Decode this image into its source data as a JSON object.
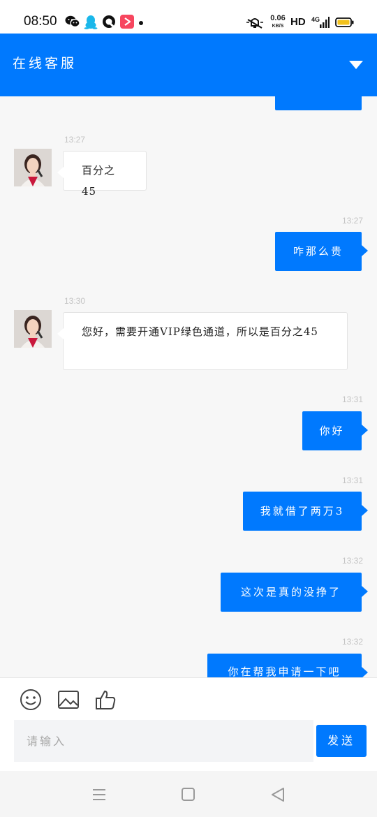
{
  "status_bar": {
    "time": "08:50",
    "net_speed_value": "0.06",
    "net_speed_unit": "KB/S",
    "hd_label": "HD",
    "signal_label": "4G",
    "apps": [
      "wechat-icon",
      "qq-icon",
      "q-app-icon",
      "video-app-icon"
    ]
  },
  "header": {
    "title": "在线客服",
    "dropdown_icon": "triangle-down-icon"
  },
  "messages": [
    {
      "side": "right",
      "text": "",
      "time": ""
    },
    {
      "side": "left",
      "time": "13:27",
      "text": "百分之45"
    },
    {
      "side": "right",
      "time": "13:27",
      "text": "咋那么贵"
    },
    {
      "side": "left",
      "time": "13:30",
      "text": "您好，需要开通VIP绿色通道，所以是百分之45"
    },
    {
      "side": "right",
      "time": "13:31",
      "text": "你好"
    },
    {
      "side": "right",
      "time": "13:31",
      "text": "我就借了两万3"
    },
    {
      "side": "right",
      "time": "13:32",
      "text": "这次是真的没挣了"
    },
    {
      "side": "right",
      "time": "13:32",
      "text": "你在帮我申请一下吧"
    }
  ],
  "toolbar": {
    "emoji_icon": "smiley-icon",
    "image_icon": "image-icon",
    "like_icon": "thumbs-up-icon"
  },
  "input": {
    "placeholder": "请输入",
    "value": ""
  },
  "send_button": {
    "label": "发送"
  },
  "navbar": {
    "icons": [
      "menu-icon",
      "home-square-icon",
      "back-triangle-icon"
    ]
  },
  "colors": {
    "brand": "#0079fe",
    "chat_bg": "#f7f7f7",
    "battery": "#f2c21d"
  }
}
